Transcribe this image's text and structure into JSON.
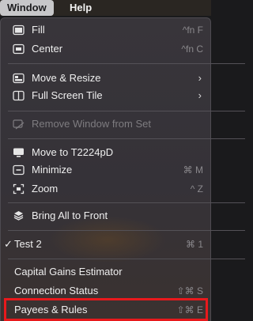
{
  "menubar": {
    "window_label": "Window",
    "help_label": "Help"
  },
  "menu": {
    "items": [
      {
        "label": "Fill",
        "shortcut": "^fn F",
        "icon": "fill-window-icon"
      },
      {
        "label": "Center",
        "shortcut": "^fn C",
        "icon": "center-window-icon"
      },
      {
        "label": "Move & Resize",
        "icon": "move-resize-icon"
      },
      {
        "label": "Full Screen Tile",
        "icon": "full-screen-tile-icon"
      },
      {
        "label": "Remove Window from Set",
        "icon": "remove-window-icon"
      },
      {
        "label": "Move to T2224pD",
        "icon": "display-icon"
      },
      {
        "label": "Minimize",
        "shortcut": "⌘ M",
        "icon": "minimize-icon"
      },
      {
        "label": "Zoom",
        "shortcut": "^ Z",
        "icon": "zoom-icon"
      },
      {
        "label": "Bring All to Front",
        "icon": "stack-icon"
      },
      {
        "label": "Test 2",
        "shortcut": "⌘ 1",
        "checked": "✓"
      },
      {
        "label": "Capital Gains Estimator"
      },
      {
        "label": "Connection Status",
        "shortcut": "⇧⌘ S"
      },
      {
        "label": "Payees & Rules",
        "shortcut": "⇧⌘ E"
      }
    ]
  },
  "colors": {
    "highlight": "#e8191c",
    "menu_bg": "#38353a"
  }
}
